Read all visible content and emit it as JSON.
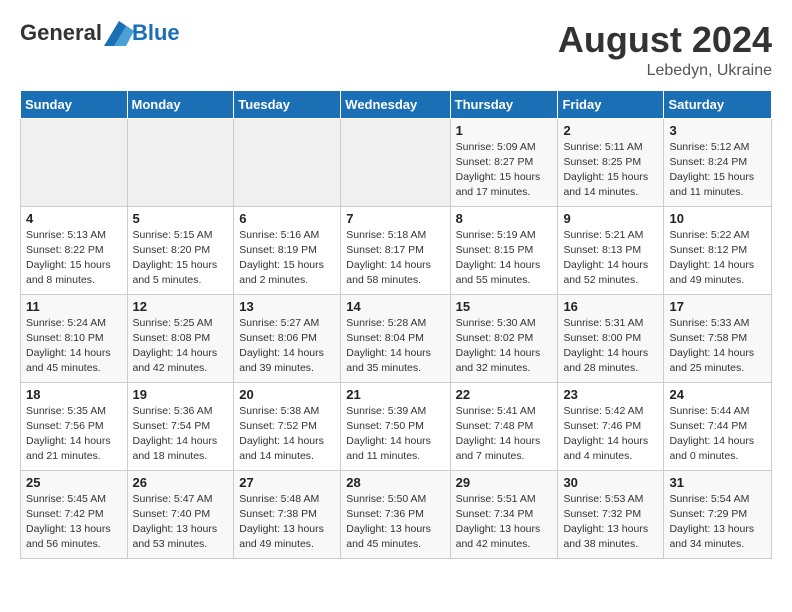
{
  "header": {
    "logo": {
      "text_general": "General",
      "text_blue": "Blue"
    },
    "main_title": "August 2024",
    "subtitle": "Lebedyn, Ukraine"
  },
  "calendar": {
    "weekdays": [
      "Sunday",
      "Monday",
      "Tuesday",
      "Wednesday",
      "Thursday",
      "Friday",
      "Saturday"
    ],
    "weeks": [
      [
        {
          "day": "",
          "info": ""
        },
        {
          "day": "",
          "info": ""
        },
        {
          "day": "",
          "info": ""
        },
        {
          "day": "",
          "info": ""
        },
        {
          "day": "1",
          "info": "Sunrise: 5:09 AM\nSunset: 8:27 PM\nDaylight: 15 hours\nand 17 minutes."
        },
        {
          "day": "2",
          "info": "Sunrise: 5:11 AM\nSunset: 8:25 PM\nDaylight: 15 hours\nand 14 minutes."
        },
        {
          "day": "3",
          "info": "Sunrise: 5:12 AM\nSunset: 8:24 PM\nDaylight: 15 hours\nand 11 minutes."
        }
      ],
      [
        {
          "day": "4",
          "info": "Sunrise: 5:13 AM\nSunset: 8:22 PM\nDaylight: 15 hours\nand 8 minutes."
        },
        {
          "day": "5",
          "info": "Sunrise: 5:15 AM\nSunset: 8:20 PM\nDaylight: 15 hours\nand 5 minutes."
        },
        {
          "day": "6",
          "info": "Sunrise: 5:16 AM\nSunset: 8:19 PM\nDaylight: 15 hours\nand 2 minutes."
        },
        {
          "day": "7",
          "info": "Sunrise: 5:18 AM\nSunset: 8:17 PM\nDaylight: 14 hours\nand 58 minutes."
        },
        {
          "day": "8",
          "info": "Sunrise: 5:19 AM\nSunset: 8:15 PM\nDaylight: 14 hours\nand 55 minutes."
        },
        {
          "day": "9",
          "info": "Sunrise: 5:21 AM\nSunset: 8:13 PM\nDaylight: 14 hours\nand 52 minutes."
        },
        {
          "day": "10",
          "info": "Sunrise: 5:22 AM\nSunset: 8:12 PM\nDaylight: 14 hours\nand 49 minutes."
        }
      ],
      [
        {
          "day": "11",
          "info": "Sunrise: 5:24 AM\nSunset: 8:10 PM\nDaylight: 14 hours\nand 45 minutes."
        },
        {
          "day": "12",
          "info": "Sunrise: 5:25 AM\nSunset: 8:08 PM\nDaylight: 14 hours\nand 42 minutes."
        },
        {
          "day": "13",
          "info": "Sunrise: 5:27 AM\nSunset: 8:06 PM\nDaylight: 14 hours\nand 39 minutes."
        },
        {
          "day": "14",
          "info": "Sunrise: 5:28 AM\nSunset: 8:04 PM\nDaylight: 14 hours\nand 35 minutes."
        },
        {
          "day": "15",
          "info": "Sunrise: 5:30 AM\nSunset: 8:02 PM\nDaylight: 14 hours\nand 32 minutes."
        },
        {
          "day": "16",
          "info": "Sunrise: 5:31 AM\nSunset: 8:00 PM\nDaylight: 14 hours\nand 28 minutes."
        },
        {
          "day": "17",
          "info": "Sunrise: 5:33 AM\nSunset: 7:58 PM\nDaylight: 14 hours\nand 25 minutes."
        }
      ],
      [
        {
          "day": "18",
          "info": "Sunrise: 5:35 AM\nSunset: 7:56 PM\nDaylight: 14 hours\nand 21 minutes."
        },
        {
          "day": "19",
          "info": "Sunrise: 5:36 AM\nSunset: 7:54 PM\nDaylight: 14 hours\nand 18 minutes."
        },
        {
          "day": "20",
          "info": "Sunrise: 5:38 AM\nSunset: 7:52 PM\nDaylight: 14 hours\nand 14 minutes."
        },
        {
          "day": "21",
          "info": "Sunrise: 5:39 AM\nSunset: 7:50 PM\nDaylight: 14 hours\nand 11 minutes."
        },
        {
          "day": "22",
          "info": "Sunrise: 5:41 AM\nSunset: 7:48 PM\nDaylight: 14 hours\nand 7 minutes."
        },
        {
          "day": "23",
          "info": "Sunrise: 5:42 AM\nSunset: 7:46 PM\nDaylight: 14 hours\nand 4 minutes."
        },
        {
          "day": "24",
          "info": "Sunrise: 5:44 AM\nSunset: 7:44 PM\nDaylight: 14 hours\nand 0 minutes."
        }
      ],
      [
        {
          "day": "25",
          "info": "Sunrise: 5:45 AM\nSunset: 7:42 PM\nDaylight: 13 hours\nand 56 minutes."
        },
        {
          "day": "26",
          "info": "Sunrise: 5:47 AM\nSunset: 7:40 PM\nDaylight: 13 hours\nand 53 minutes."
        },
        {
          "day": "27",
          "info": "Sunrise: 5:48 AM\nSunset: 7:38 PM\nDaylight: 13 hours\nand 49 minutes."
        },
        {
          "day": "28",
          "info": "Sunrise: 5:50 AM\nSunset: 7:36 PM\nDaylight: 13 hours\nand 45 minutes."
        },
        {
          "day": "29",
          "info": "Sunrise: 5:51 AM\nSunset: 7:34 PM\nDaylight: 13 hours\nand 42 minutes."
        },
        {
          "day": "30",
          "info": "Sunrise: 5:53 AM\nSunset: 7:32 PM\nDaylight: 13 hours\nand 38 minutes."
        },
        {
          "day": "31",
          "info": "Sunrise: 5:54 AM\nSunset: 7:29 PM\nDaylight: 13 hours\nand 34 minutes."
        }
      ]
    ]
  }
}
